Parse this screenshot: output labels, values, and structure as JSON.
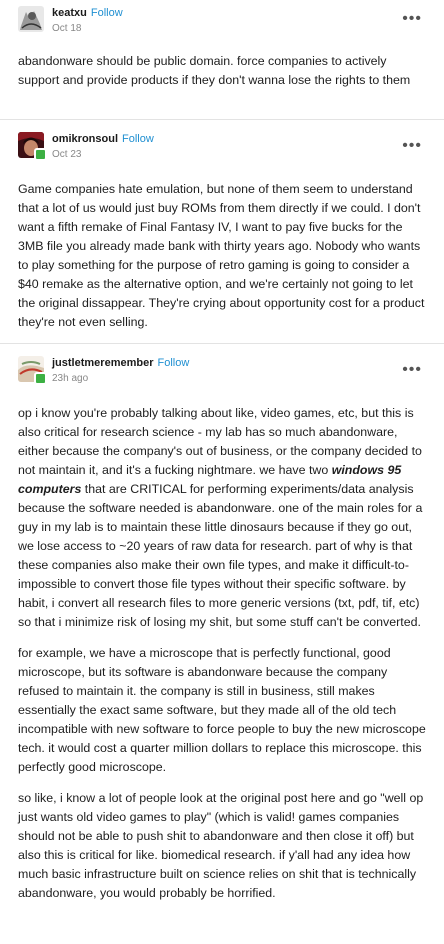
{
  "posts": [
    {
      "username": "keatxu",
      "follow": "Follow",
      "date": "Oct 18",
      "paragraphs": [
        "abandonware should be public domain. force companies to actively support and provide products if they don't wanna lose the rights to them"
      ]
    },
    {
      "username": "omikronsoul",
      "follow": "Follow",
      "date": "Oct 23",
      "paragraphs": [
        "Game companies hate emulation, but none of them seem to understand that a lot of us would just buy ROMs from them directly if we could. I don't want a fifth remake of Final Fantasy IV, I want to pay five bucks for the 3MB file you already made bank with thirty years ago. Nobody who wants to play something for the purpose of retro gaming is going to consider a $40 remake as the alternative option, and we're certainly not going to let the original dissappear. They're crying about opportunity cost for a product they're not even selling."
      ]
    },
    {
      "username": "justletmeremember",
      "follow": "Follow",
      "date": "23h ago",
      "p1_a": "op i know you're probably talking about like, video games, etc, but this is also critical for research science - my lab has so much abandonware, either because the company's out of business, or the company decided to not maintain it, and it's a fucking nightmare. we have two ",
      "p1_bold": "windows 95 computers",
      "p1_b": " that are CRITICAL for performing experiments/data analysis because the software needed is abandonware. one of the main roles for a guy in my lab is to maintain these little dinosaurs because if they go out, we lose access to ~20 years of raw data for research. part of why is that these companies also make their own file types, and make it difficult-to-impossible to convert those file types without their specific software. by habit, i convert all research files to more generic versions (txt, pdf, tif, etc) so that i minimize risk of losing my shit, but some stuff can't be converted.",
      "p2": "for example, we have a microscope that is perfectly functional, good microscope, but its software is abandonware because the company refused to maintain it. the company is still in business, still makes essentially the exact same software, but they made all of the old tech incompatible with new software to force people to buy the new microscope tech. it would cost a quarter million dollars to replace this microscope. this perfectly good microscope.",
      "p3": "so like, i know a lot of people look at the original post here and go \"well op just wants old video games to play\" (which is valid! games companies should not be able to push shit to abandonware and then close it off) but also this is critical for like. biomedical research. if y'all had any idea how much basic infrastructure built on science relies on shit that is technically abandonware, you would probably be horrified."
    }
  ],
  "more_glyph": "•••"
}
